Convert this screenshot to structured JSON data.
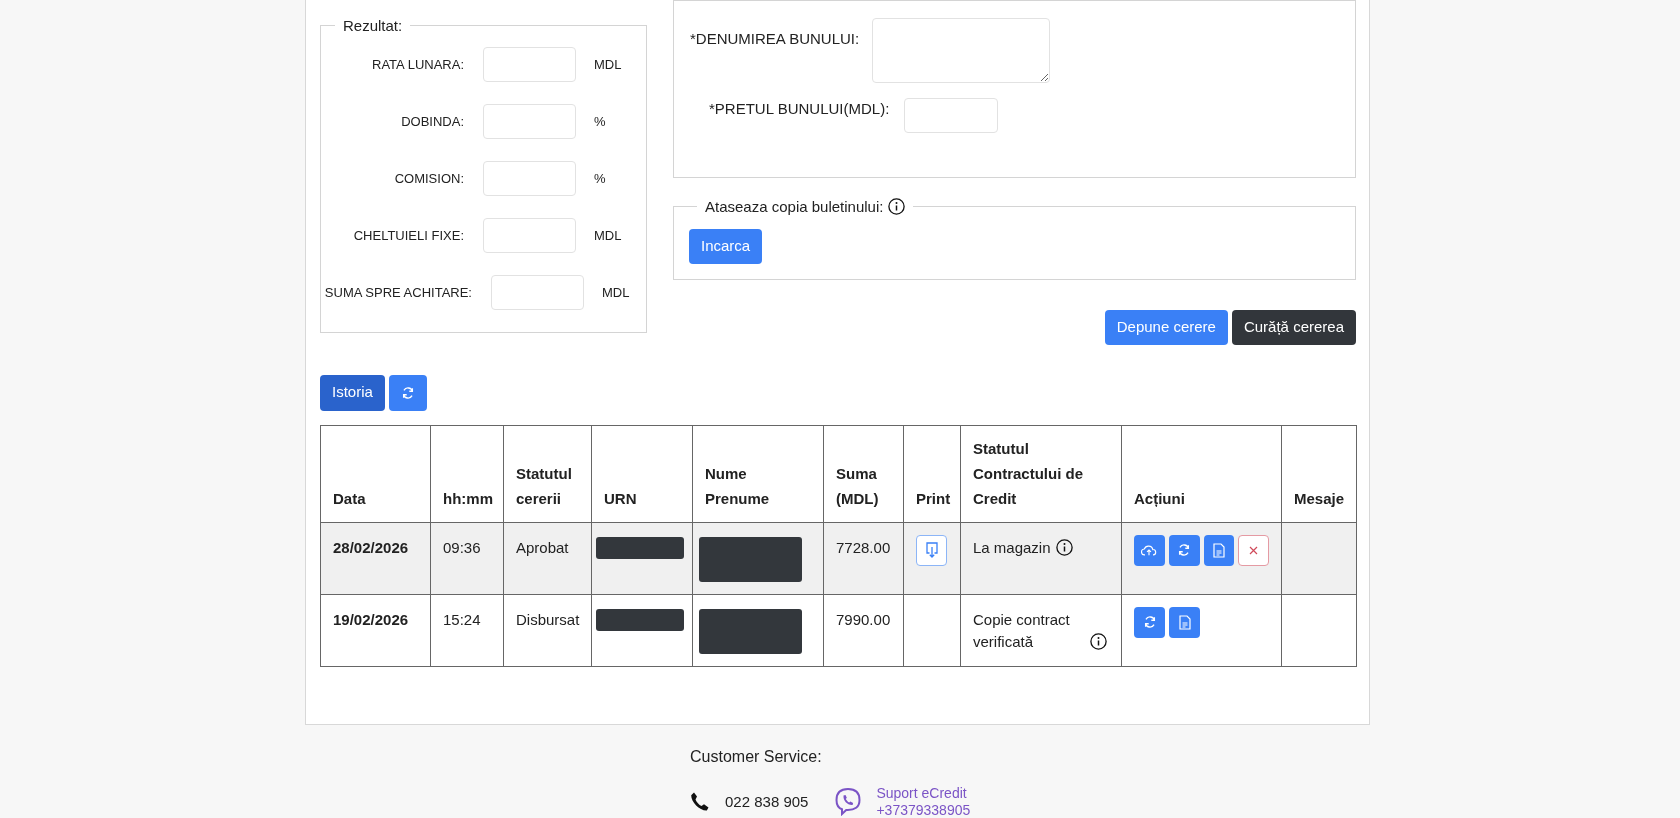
{
  "result_panel": {
    "legend": "Rezultat:",
    "fields": [
      {
        "label": "RATA LUNARA:",
        "unit": "MDL"
      },
      {
        "label": "DOBINDA:",
        "unit": "%"
      },
      {
        "label": "COMISION:",
        "unit": "%"
      },
      {
        "label": "CHELTUIELI FIXE:",
        "unit": "MDL"
      },
      {
        "label": "SUMA SPRE ACHITARE:",
        "unit": "MDL"
      }
    ]
  },
  "goods_panel": {
    "fields": [
      {
        "label": "*DENUMIREA BUNULUI:",
        "kind": "textarea"
      },
      {
        "label": "*PRETUL BUNULUI(MDL):",
        "kind": "input"
      }
    ]
  },
  "attachment": {
    "legend": "Ataseaza copia buletinului:",
    "info": true,
    "button": "Incarca"
  },
  "form_buttons": [
    {
      "label": "Depune cerere",
      "kind": "primary"
    },
    {
      "label": "Curăță cererea",
      "kind": "dark"
    }
  ],
  "history_toolbar": [
    {
      "kind": "text",
      "label": "Istoria",
      "active": true
    },
    {
      "kind": "refresh",
      "active": false
    }
  ],
  "table": {
    "columns": [
      "Data",
      "hh:mm",
      "Statutul cererii",
      "URN",
      "Nume Prenume",
      "Suma (MDL)",
      "Print",
      "Statutul Contractului de Credit",
      "Acțiuni",
      "Mesaje"
    ],
    "rows": [
      {
        "selected": true,
        "date": "28/02/2026",
        "time": "09:36",
        "status": "Aprobat",
        "urn_redacted": true,
        "name_redacted": true,
        "amount": "7728.00",
        "print": {
          "kind": "download"
        },
        "contract_status": "La magazin",
        "contract_info": true,
        "actions": [
          {
            "kind": "upload"
          },
          {
            "kind": "refresh"
          },
          {
            "kind": "document"
          },
          {
            "kind": "delete"
          }
        ]
      },
      {
        "selected": false,
        "date": "19/02/2026",
        "time": "15:24",
        "status": "Disbursat",
        "urn_redacted": true,
        "name_redacted": true,
        "amount": "7990.00",
        "contract_status": "Copie contract verificată",
        "contract_info": true,
        "actions": [
          {
            "kind": "refresh"
          },
          {
            "kind": "document"
          }
        ]
      }
    ]
  },
  "footer": {
    "title": "Customer Service:",
    "phone": "022 838 905",
    "viber_name": "Suport eCredit",
    "viber_number": "+37379338905"
  }
}
